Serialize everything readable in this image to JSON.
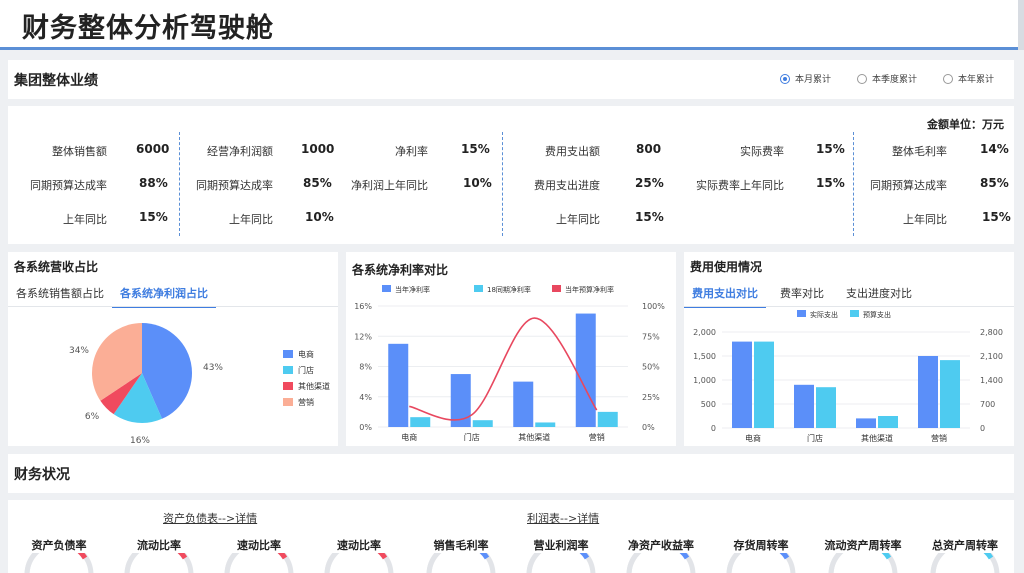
{
  "header": {
    "title": "财务整体分析驾驶舱"
  },
  "group": {
    "title": "集团整体业绩",
    "radios": [
      {
        "label": "本月累计",
        "selected": true
      },
      {
        "label": "本季度累计",
        "selected": false
      },
      {
        "label": "本年累计",
        "selected": false
      }
    ],
    "unit": "金额单位：万元",
    "kpis": [
      {
        "label": "整体销售额",
        "value": "6000"
      },
      {
        "label": "同期预算达成率",
        "value": "88%"
      },
      {
        "label": "上年同比",
        "value": "15%"
      },
      {
        "label": "经营净利润额",
        "value": "1000"
      },
      {
        "label": "同期预算达成率",
        "value": "85%"
      },
      {
        "label": "上年同比",
        "value": "10%"
      },
      {
        "label": "净利率",
        "value": "15%"
      },
      {
        "label": "净利润上年同比",
        "value": "10%"
      },
      {
        "label": "费用支出额",
        "value": "800"
      },
      {
        "label": "费用支出进度",
        "value": "25%"
      },
      {
        "label": "上年同比",
        "value": "15%"
      },
      {
        "label": "实际费率",
        "value": "15%"
      },
      {
        "label": "实际费率上年同比",
        "value": "15%"
      },
      {
        "label": "整体毛利率",
        "value": "14%"
      },
      {
        "label": "同期预算达成率",
        "value": "85%"
      },
      {
        "label": "上年同比",
        "value": "15%"
      }
    ]
  },
  "revenue_panel": {
    "title": "各系统营收占比",
    "tabs": [
      "各系统销售额占比",
      "各系统净利润占比"
    ],
    "active_tab": 1
  },
  "margin_panel": {
    "title": "各系统净利率对比"
  },
  "expense_panel": {
    "title": "费用使用情况",
    "tabs": [
      "费用支出对比",
      "费率对比",
      "支出进度对比"
    ],
    "active_tab": 0
  },
  "finance": {
    "title": "财务状况",
    "links": [
      "资产负债表-->详情",
      "利润表-->详情"
    ],
    "ratios": [
      "资产负债率",
      "流动比率",
      "速动比率",
      "速动比率",
      "销售毛利率",
      "营业利润率",
      "净资产收益率",
      "存货周转率",
      "流动资产周转率",
      "总资产周转率"
    ],
    "gauge_colors": [
      "#f04a5e",
      "#f04a5e",
      "#f04a5e",
      "#f04a5e",
      "#5b8ff9",
      "#5b8ff9",
      "#5b8ff9",
      "#5b8ff9",
      "#4ecbf0",
      "#4ecbf0"
    ]
  },
  "chart_data": [
    {
      "type": "pie",
      "labels": [
        "电商",
        "门店",
        "其他渠道",
        "营销"
      ],
      "values": [
        43,
        16,
        6,
        34
      ],
      "value_labels": [
        "43%",
        "16%",
        "6%",
        "34%"
      ],
      "colors": [
        "#5b8ff9",
        "#4ecbf0",
        "#f04a5e",
        "#fbae96"
      ],
      "legend": "right"
    },
    {
      "type": "bar",
      "categories": [
        "电商",
        "门店",
        "其他渠道",
        "营销"
      ],
      "series": [
        {
          "name": "当年净利率",
          "type": "bar",
          "axis": "left",
          "color": "#5b8ff9",
          "values": [
            11,
            7,
            6,
            15
          ]
        },
        {
          "name": "18同期净利率",
          "type": "bar",
          "axis": "left",
          "color": "#4ecbf0",
          "values": [
            1.3,
            0.9,
            0.6,
            2.0
          ]
        },
        {
          "name": "当年预算净利率",
          "type": "line",
          "axis": "right",
          "color": "#e8485f",
          "values": [
            17,
            10,
            90,
            14
          ]
        }
      ],
      "y_left": {
        "ticks": [
          "0%",
          "4%",
          "8%",
          "12%",
          "16%"
        ],
        "range": [
          0,
          16
        ]
      },
      "y_right": {
        "ticks": [
          "0%",
          "25%",
          "50%",
          "75%",
          "100%"
        ],
        "range": [
          0,
          100
        ]
      },
      "legend": "top"
    },
    {
      "type": "bar",
      "categories": [
        "电商",
        "门店",
        "其他渠道",
        "营销"
      ],
      "series": [
        {
          "name": "实际支出",
          "color": "#5b8ff9",
          "values": [
            1800,
            900,
            200,
            1500
          ]
        },
        {
          "name": "预算支出",
          "color": "#4ecbf0",
          "values": [
            2520,
            1190,
            350,
            1980
          ]
        }
      ],
      "y_left": {
        "ticks": [
          "0",
          "500",
          "1,000",
          "1,500",
          "2,000"
        ],
        "range": [
          0,
          2000
        ]
      },
      "y_right": {
        "ticks": [
          "0",
          "700",
          "1,400",
          "2,100",
          "2,800"
        ],
        "range": [
          0,
          2800
        ]
      },
      "legend": "top"
    }
  ]
}
